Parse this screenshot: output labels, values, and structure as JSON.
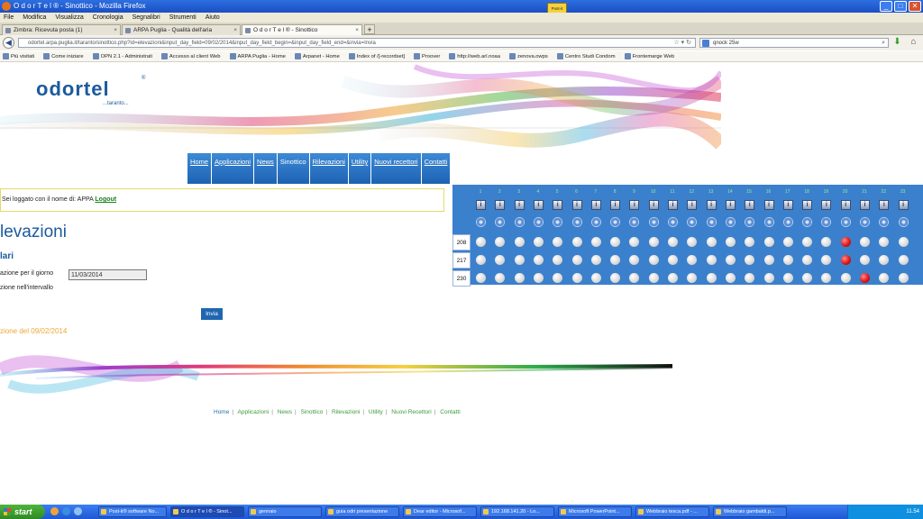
{
  "window": {
    "title": "O d o r T e l ® - Sinottico - Mozilla Firefox",
    "controls": [
      "_",
      "□",
      "✕"
    ],
    "notepad_label": "Post-it Notes"
  },
  "menubar": [
    "File",
    "Modifica",
    "Visualizza",
    "Cronologia",
    "Segnalibri",
    "Strumenti",
    "Aiuto"
  ],
  "tabs": [
    {
      "label": "Zimbra: Ricevuta posta (1)"
    },
    {
      "label": "ARPA Puglia - Qualità dell'aria"
    },
    {
      "label": "O d o r T e l ® - Sinottico"
    }
  ],
  "navbar": {
    "url": "odortel.arpa.puglia.it/taranto/sinottico.php?id=elevazioni&input_day_field=09/02/2014&input_day_field_begin=&input_day_field_end=&invia=Invia",
    "search_value": "qnock 25w"
  },
  "bookmarks": [
    "Più visitati",
    "Come iniziare",
    "OPN 2.1 - Administrati",
    "Accesso al client Web",
    "ARPA Puglia - Home",
    "Arpanet - Home",
    "Index of /[-recordset]",
    "Proover",
    "http://web.arl.noaa",
    "zenova.owps",
    "Centro Studi Condom",
    "Frontemarge Web"
  ],
  "logo": {
    "name": "odortel",
    "reg": "®",
    "sub": "...taranto..."
  },
  "site_nav": [
    "Home",
    "Applicazioni",
    "News",
    "Sinottico",
    "Rilevazioni",
    "Utility",
    "Nuovi recettori",
    "Contatti"
  ],
  "login": {
    "text": "Sei loggato con il nome di: APPA",
    "logout": "Logout"
  },
  "page_title": "levazioni",
  "subheading": "lari",
  "form": {
    "day_label": "azione per il giorno",
    "day_value": "11/03/2014",
    "interval_label": "zione nell'intervallo",
    "submit": "Invia"
  },
  "elevation_date": "zione del 09/02/2014",
  "footer_links": [
    "Home",
    "Applicazioni",
    "News",
    "Sinottico",
    "Rilevazioni",
    "Utility",
    "Nuovi Recettori",
    "Contatti"
  ],
  "sinottico": {
    "column_count": 23,
    "columns": [
      "1",
      "2",
      "3",
      "4",
      "5",
      "6",
      "7",
      "8",
      "9",
      "10",
      "11",
      "12",
      "13",
      "14",
      "15",
      "16",
      "17",
      "18",
      "19",
      "20",
      "21",
      "22",
      "23"
    ],
    "rows": [
      {
        "id": "208",
        "alerts": [
          20
        ]
      },
      {
        "id": "217",
        "alerts": [
          20
        ]
      },
      {
        "id": "230",
        "alerts": [
          21
        ]
      }
    ],
    "colors": {
      "normal": "#d9d9d9",
      "alert": "#e01818",
      "panel": "#3b80cc"
    }
  },
  "taskbar": {
    "start": "start",
    "tasks": [
      "Post-it® software No...",
      "O d o r T e l ® - Sinot...",
      "gennaio",
      "guia odri presentazione",
      "Dear editor - Microsof...",
      "192.168.141.20 - Lo...",
      "Microsoft PowerPoint...",
      "Webbraio tesca.pdf - ...",
      "Webbraio gambaldi.p..."
    ],
    "clock": "11.54"
  }
}
